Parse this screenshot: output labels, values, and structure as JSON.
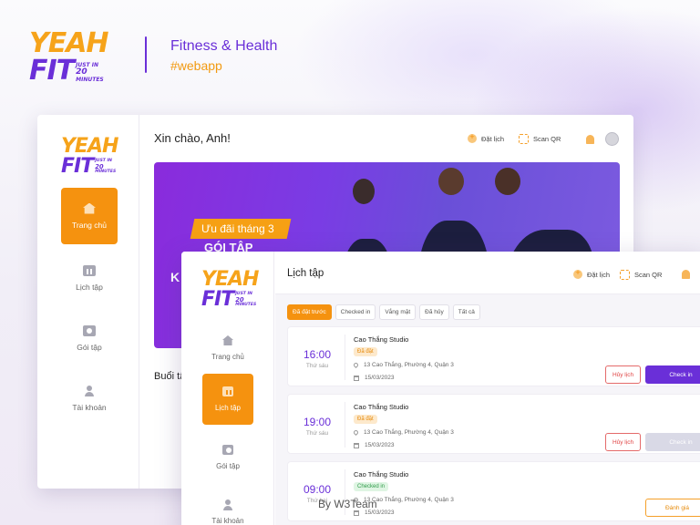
{
  "brand": {
    "logo_top": "YEAH",
    "logo_bottom": "FIT",
    "logo_tag_1": "JUST IN",
    "logo_tag_2": "20",
    "logo_tag_3": "MINUTES",
    "title": "Fitness & Health",
    "hashtag": "#webapp"
  },
  "home_screen": {
    "greeting": "Xin chào, Anh!",
    "book_label": "Đặt lịch",
    "scan_label": "Scan QR",
    "nav": [
      "Trang chủ",
      "Lịch tập",
      "Gói tập",
      "Tài khoản"
    ],
    "promo_label": "Ưu đãi tháng 3",
    "banner_line_1": "GÓI TẬP",
    "banner_line_2": "K",
    "section_title": "Buổi tậ"
  },
  "schedule_screen": {
    "title": "Lịch tập",
    "book_label": "Đặt lịch",
    "scan_label": "Scan QR",
    "nav": [
      "Trang chủ",
      "Lịch tập",
      "Gói tập",
      "Tài khoản"
    ],
    "filters": [
      "Đã đặt trước",
      "Checked in",
      "Vắng mặt",
      "Đã hủy",
      "Tất cả"
    ],
    "sessions": [
      {
        "time": "16:00",
        "day": "Thứ sáu",
        "studio": "Cao Thắng Studio",
        "status": "Đã đặt",
        "address": "13 Cao Thắng, Phường 4, Quận 3",
        "date": "15/03/2023",
        "cancel": "Hủy lịch",
        "action": "Check in"
      },
      {
        "time": "19:00",
        "day": "Thứ sáu",
        "studio": "Cao Thắng Studio",
        "status": "Đã đặt",
        "address": "13 Cao Thắng, Phường 4, Quận 3",
        "date": "15/03/2023",
        "cancel": "Hủy lịch",
        "action": "Check in"
      },
      {
        "time": "09:00",
        "day": "Thứ hai",
        "studio": "Cao Thắng Studio",
        "status": "Checked in",
        "address": "13 Cao Thắng, Phường 4, Quận 3",
        "date": "15/03/2023",
        "action": "Đánh giá"
      }
    ]
  },
  "credit": "By W3Team",
  "colors": {
    "primary": "#6a2fd8",
    "accent": "#f5920f",
    "danger": "#e04444"
  },
  "icons": [
    "home-icon",
    "calendar-icon",
    "ticket-icon",
    "user-icon",
    "bell-icon",
    "qr-icon",
    "plus-icon",
    "pin-icon"
  ]
}
